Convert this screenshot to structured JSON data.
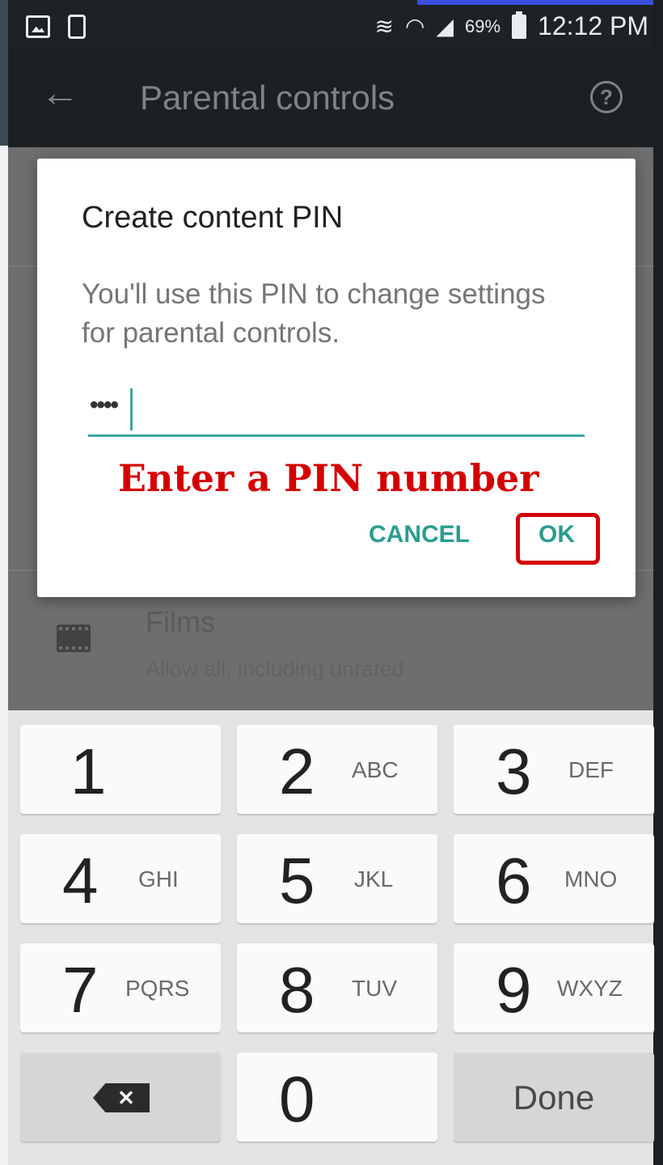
{
  "status_bar": {
    "left_icons": [
      "image-icon",
      "phone-icon"
    ],
    "right_icons": [
      "vibrate-icon",
      "wifi-icon",
      "signal-icon",
      "battery-icon"
    ],
    "battery_percent": "69%",
    "time": "12:12 PM"
  },
  "app_bar": {
    "back_icon": "arrow-left-icon",
    "title": "Parental controls",
    "help_icon": "question-circle-icon",
    "help_glyph": "?"
  },
  "background_list": {
    "films": {
      "icon": "film-icon",
      "title": "Films",
      "subtitle": "Allow all, including unrated"
    }
  },
  "dialog": {
    "title": "Create content PIN",
    "body": "You'll use this PIN to change settings for parental controls.",
    "pin_value": "••••",
    "annotation": "Enter a PIN number",
    "cancel_label": "CANCEL",
    "ok_label": "OK"
  },
  "keypad": {
    "keys": [
      {
        "digit": "1",
        "letters": ""
      },
      {
        "digit": "2",
        "letters": "ABC"
      },
      {
        "digit": "3",
        "letters": "DEF"
      },
      {
        "digit": "4",
        "letters": "GHI"
      },
      {
        "digit": "5",
        "letters": "JKL"
      },
      {
        "digit": "6",
        "letters": "MNO"
      },
      {
        "digit": "7",
        "letters": "PQRS"
      },
      {
        "digit": "8",
        "letters": "TUV"
      },
      {
        "digit": "9",
        "letters": "WXYZ"
      },
      {
        "digit": "0",
        "letters": ""
      }
    ],
    "backspace_glyph": "✕",
    "done_label": "Done"
  },
  "colors": {
    "accent": "#2a9d8f",
    "annotation": "#d40000",
    "app_bar": "#1b2023"
  }
}
